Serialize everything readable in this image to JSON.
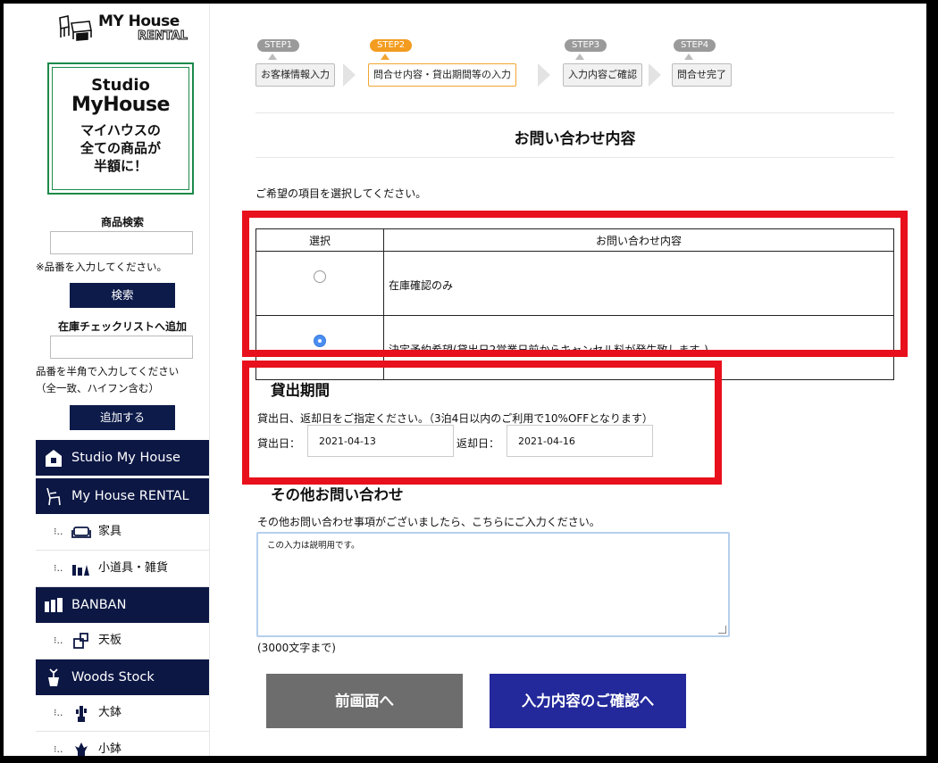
{
  "sidebar": {
    "logo_text": "MY House",
    "logo_sub": "RENTAL",
    "promo": {
      "line1": "Studio",
      "line2": "MyHouse",
      "line3": "マイハウスの",
      "line4": "全ての商品が",
      "line5": "半額に！"
    },
    "search": {
      "heading": "商品検索",
      "placeholder": "",
      "note": "※品番を入力してください。",
      "button": "検索"
    },
    "checklist": {
      "heading": "在庫チェックリストへ追加",
      "placeholder": "",
      "note1": "品番を半角で入力してください",
      "note2": "（全一致、ハイフン含む）",
      "button": "追加する"
    },
    "categories": [
      {
        "label": "Studio My House"
      },
      {
        "label": "My House RENTAL"
      },
      {
        "label": "家具"
      },
      {
        "label": "小道具・雑貨"
      },
      {
        "label": "BANBAN"
      },
      {
        "label": "天板"
      },
      {
        "label": "Woods Stock"
      },
      {
        "label": "大鉢"
      },
      {
        "label": "小鉢"
      }
    ]
  },
  "steps": [
    {
      "badge": "STEP1",
      "label": "お客様情報入力",
      "active": false
    },
    {
      "badge": "STEP2",
      "label": "問合せ内容・貸出期間等の入力",
      "active": true
    },
    {
      "badge": "STEP3",
      "label": "入力内容ご確認",
      "active": false
    },
    {
      "badge": "STEP4",
      "label": "問合せ完了",
      "active": false
    }
  ],
  "form": {
    "title": "お問い合わせ内容",
    "intro": "ご希望の項目を選択してください。",
    "table": {
      "headers": [
        "選択",
        "お問い合わせ内容"
      ],
      "rows": [
        {
          "text": "在庫確認のみ",
          "selected": false
        },
        {
          "text": "決定予約希望(貸出日2営業日前からキャンセル料が発生致します。)",
          "selected": true
        }
      ]
    },
    "period": {
      "heading": "貸出期間",
      "note": "貸出日、返却日をご指定ください。（3泊4日以内のご利用で10%OFFとなります）",
      "start_label": "貸出日：",
      "start_value": "2021-04-13",
      "end_label": "返却日：",
      "end_value": "2021-04-16"
    },
    "other": {
      "heading": "その他お問い合わせ",
      "note": "その他お問い合わせ事項がございましたら、こちらにご入力ください。",
      "textarea_value": "この入力は説明用です。",
      "limit": "(3000文字まで)"
    },
    "buttons": {
      "back": "前画面へ",
      "next": "入力内容のご確認へ"
    }
  },
  "colors": {
    "nav_bg": "#0c1744",
    "active_step": "#f39c1f",
    "annotation": "#e8101c",
    "next_button": "#23289a",
    "back_button": "#6d6d6d",
    "promo_border": "#1c8a4a"
  }
}
